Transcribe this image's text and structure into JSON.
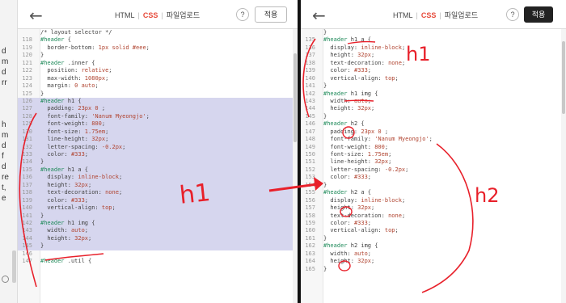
{
  "left": {
    "sidebar_chars": [
      "d",
      "m",
      "d",
      "rr",
      "",
      "",
      "",
      "h",
      "m",
      "d",
      "f",
      "d",
      "re",
      "t,",
      "e",
      ""
    ],
    "tabs": [
      {
        "label": "HTML",
        "active": false
      },
      {
        "label": "CSS",
        "active": true
      },
      {
        "label": "파일업로드",
        "active": false
      }
    ],
    "help_label": "?",
    "apply_label": "적용",
    "lines": [
      {
        "n": "",
        "parts": [
          [
            "c",
            "/* layout selector */"
          ]
        ]
      },
      {
        "n": "118",
        "parts": [
          [
            "s",
            "#header"
          ],
          [
            "p",
            " {"
          ]
        ]
      },
      {
        "n": "119",
        "parts": [
          [
            "p",
            "  border-bottom: "
          ],
          [
            "v",
            "1px solid #eee"
          ],
          [
            "p",
            ";"
          ]
        ]
      },
      {
        "n": "120",
        "parts": [
          [
            "p",
            "}"
          ]
        ]
      },
      {
        "n": "121",
        "parts": [
          [
            "s",
            "#header"
          ],
          [
            "p",
            " .inner {"
          ]
        ]
      },
      {
        "n": "122",
        "parts": [
          [
            "p",
            "  position: "
          ],
          [
            "v",
            "relative"
          ],
          [
            "p",
            ";"
          ]
        ]
      },
      {
        "n": "123",
        "parts": [
          [
            "p",
            "  max-width: "
          ],
          [
            "v",
            "1080px"
          ],
          [
            "p",
            ";"
          ]
        ]
      },
      {
        "n": "124",
        "parts": [
          [
            "p",
            "  margin: "
          ],
          [
            "v",
            "0 auto"
          ],
          [
            "p",
            ";"
          ]
        ]
      },
      {
        "n": "125",
        "parts": [
          [
            "p",
            "}"
          ]
        ]
      },
      {
        "n": "126",
        "hl": true,
        "parts": [
          [
            "s",
            "#header"
          ],
          [
            "p",
            " h1 {"
          ]
        ]
      },
      {
        "n": "127",
        "hl": true,
        "parts": [
          [
            "p",
            "  padding: "
          ],
          [
            "v",
            "23px 0"
          ],
          [
            "p",
            " ;"
          ]
        ]
      },
      {
        "n": "128",
        "hl": true,
        "parts": [
          [
            "p",
            "  font-family: "
          ],
          [
            "v",
            "'Nanum Myeongjo'"
          ],
          [
            "p",
            ";"
          ]
        ]
      },
      {
        "n": "129",
        "hl": true,
        "parts": [
          [
            "p",
            "  font-weight: "
          ],
          [
            "v",
            "800"
          ],
          [
            "p",
            ";"
          ]
        ]
      },
      {
        "n": "130",
        "hl": true,
        "parts": [
          [
            "p",
            "  font-size: "
          ],
          [
            "v",
            "1.75em"
          ],
          [
            "p",
            ";"
          ]
        ]
      },
      {
        "n": "131",
        "hl": true,
        "parts": [
          [
            "p",
            "  line-height: "
          ],
          [
            "v",
            "32px"
          ],
          [
            "p",
            ";"
          ]
        ]
      },
      {
        "n": "132",
        "hl": true,
        "parts": [
          [
            "p",
            "  letter-spacing: "
          ],
          [
            "v",
            "-0.2px"
          ],
          [
            "p",
            ";"
          ]
        ]
      },
      {
        "n": "133",
        "hl": true,
        "parts": [
          [
            "p",
            "  color: "
          ],
          [
            "v",
            "#333"
          ],
          [
            "p",
            ";"
          ]
        ]
      },
      {
        "n": "134",
        "hl": true,
        "parts": [
          [
            "p",
            "}"
          ]
        ]
      },
      {
        "n": "135",
        "hl": true,
        "parts": [
          [
            "s",
            "#header"
          ],
          [
            "p",
            " h1 a {"
          ]
        ]
      },
      {
        "n": "136",
        "hl": true,
        "parts": [
          [
            "p",
            "  display: "
          ],
          [
            "v",
            "inline-block"
          ],
          [
            "p",
            ";"
          ]
        ]
      },
      {
        "n": "137",
        "hl": true,
        "parts": [
          [
            "p",
            "  height: "
          ],
          [
            "v",
            "32px"
          ],
          [
            "p",
            ";"
          ]
        ]
      },
      {
        "n": "138",
        "hl": true,
        "parts": [
          [
            "p",
            "  text-decoration: "
          ],
          [
            "v",
            "none"
          ],
          [
            "p",
            ";"
          ]
        ]
      },
      {
        "n": "139",
        "hl": true,
        "parts": [
          [
            "p",
            "  color: "
          ],
          [
            "v",
            "#333"
          ],
          [
            "p",
            ";"
          ]
        ]
      },
      {
        "n": "140",
        "hl": true,
        "parts": [
          [
            "p",
            "  vertical-align: "
          ],
          [
            "v",
            "top"
          ],
          [
            "p",
            ";"
          ]
        ]
      },
      {
        "n": "141",
        "hl": true,
        "parts": [
          [
            "p",
            "}"
          ]
        ]
      },
      {
        "n": "142",
        "hl": true,
        "parts": [
          [
            "s",
            "#header"
          ],
          [
            "p",
            " h1 img {"
          ]
        ]
      },
      {
        "n": "143",
        "hl": true,
        "parts": [
          [
            "p",
            "  width: "
          ],
          [
            "v",
            "auto"
          ],
          [
            "p",
            ";"
          ]
        ]
      },
      {
        "n": "144",
        "hl": true,
        "parts": [
          [
            "p",
            "  height: "
          ],
          [
            "v",
            "32px"
          ],
          [
            "p",
            ";"
          ]
        ]
      },
      {
        "n": "145",
        "hl": true,
        "parts": [
          [
            "p",
            "}"
          ]
        ]
      },
      {
        "n": "146",
        "parts": [
          [
            "p",
            ""
          ]
        ]
      },
      {
        "n": "147",
        "parts": [
          [
            "s",
            "#header"
          ],
          [
            "p",
            " .util {"
          ]
        ]
      }
    ],
    "annotation": "h1"
  },
  "right": {
    "tabs": [
      {
        "label": "HTML",
        "active": false
      },
      {
        "label": "CSS",
        "active": true
      },
      {
        "label": "파일업로드",
        "active": false
      }
    ],
    "help_label": "?",
    "apply_label": "적용",
    "lines": [
      {
        "n": "",
        "parts": [
          [
            "p",
            "}"
          ]
        ]
      },
      {
        "n": "135",
        "parts": [
          [
            "s",
            "#header"
          ],
          [
            "p",
            " h1 a {"
          ]
        ]
      },
      {
        "n": "136",
        "parts": [
          [
            "p",
            "  display: "
          ],
          [
            "v",
            "inline-block"
          ],
          [
            "p",
            ";"
          ]
        ]
      },
      {
        "n": "137",
        "parts": [
          [
            "p",
            "  height: "
          ],
          [
            "v",
            "32px"
          ],
          [
            "p",
            ";"
          ]
        ]
      },
      {
        "n": "138",
        "parts": [
          [
            "p",
            "  text-decoration: "
          ],
          [
            "v",
            "none"
          ],
          [
            "p",
            ";"
          ]
        ]
      },
      {
        "n": "139",
        "parts": [
          [
            "p",
            "  color: "
          ],
          [
            "v",
            "#333"
          ],
          [
            "p",
            ";"
          ]
        ]
      },
      {
        "n": "140",
        "parts": [
          [
            "p",
            "  vertical-align: "
          ],
          [
            "v",
            "top"
          ],
          [
            "p",
            ";"
          ]
        ]
      },
      {
        "n": "141",
        "parts": [
          [
            "p",
            "}"
          ]
        ]
      },
      {
        "n": "142",
        "parts": [
          [
            "s",
            "#header"
          ],
          [
            "p",
            " h1 img {"
          ]
        ]
      },
      {
        "n": "143",
        "parts": [
          [
            "p",
            "  width: "
          ],
          [
            "v",
            "auto"
          ],
          [
            "p",
            ";"
          ]
        ]
      },
      {
        "n": "144",
        "parts": [
          [
            "p",
            "  height: "
          ],
          [
            "v",
            "32px"
          ],
          [
            "p",
            ";"
          ]
        ]
      },
      {
        "n": "145",
        "parts": [
          [
            "p",
            "}"
          ]
        ]
      },
      {
        "n": "146",
        "parts": [
          [
            "s",
            "#header"
          ],
          [
            "p",
            " h2 {"
          ]
        ]
      },
      {
        "n": "147",
        "parts": [
          [
            "p",
            "  padding: "
          ],
          [
            "v",
            "23px 0"
          ],
          [
            "p",
            " ;"
          ]
        ]
      },
      {
        "n": "148",
        "parts": [
          [
            "p",
            "  font-family: "
          ],
          [
            "v",
            "'Nanum Myeongjo'"
          ],
          [
            "p",
            ";"
          ]
        ]
      },
      {
        "n": "149",
        "parts": [
          [
            "p",
            "  font-weight: "
          ],
          [
            "v",
            "800"
          ],
          [
            "p",
            ";"
          ]
        ]
      },
      {
        "n": "150",
        "parts": [
          [
            "p",
            "  font-size: "
          ],
          [
            "v",
            "1.75em"
          ],
          [
            "p",
            ";"
          ]
        ]
      },
      {
        "n": "151",
        "parts": [
          [
            "p",
            "  line-height: "
          ],
          [
            "v",
            "32px"
          ],
          [
            "p",
            ";"
          ]
        ]
      },
      {
        "n": "152",
        "parts": [
          [
            "p",
            "  letter-spacing: "
          ],
          [
            "v",
            "-0.2px"
          ],
          [
            "p",
            ";"
          ]
        ]
      },
      {
        "n": "153",
        "parts": [
          [
            "p",
            "  color: "
          ],
          [
            "v",
            "#333"
          ],
          [
            "p",
            ";"
          ]
        ]
      },
      {
        "n": "154",
        "parts": [
          [
            "p",
            "}"
          ]
        ]
      },
      {
        "n": "155",
        "parts": [
          [
            "s",
            "#header"
          ],
          [
            "p",
            " h2 a {"
          ]
        ]
      },
      {
        "n": "156",
        "parts": [
          [
            "p",
            "  display: "
          ],
          [
            "v",
            "inline-block"
          ],
          [
            "p",
            ";"
          ]
        ]
      },
      {
        "n": "157",
        "parts": [
          [
            "p",
            "  height: "
          ],
          [
            "v",
            "32px"
          ],
          [
            "p",
            ";"
          ]
        ]
      },
      {
        "n": "158",
        "parts": [
          [
            "p",
            "  text-decoration: "
          ],
          [
            "v",
            "none"
          ],
          [
            "p",
            ";"
          ]
        ]
      },
      {
        "n": "159",
        "parts": [
          [
            "p",
            "  color: "
          ],
          [
            "v",
            "#333"
          ],
          [
            "p",
            ";"
          ]
        ]
      },
      {
        "n": "160",
        "parts": [
          [
            "p",
            "  vertical-align: "
          ],
          [
            "v",
            "top"
          ],
          [
            "p",
            ";"
          ]
        ]
      },
      {
        "n": "161",
        "parts": [
          [
            "p",
            "}"
          ]
        ]
      },
      {
        "n": "162",
        "parts": [
          [
            "s",
            "#header"
          ],
          [
            "p",
            " h2 img {"
          ]
        ]
      },
      {
        "n": "163",
        "parts": [
          [
            "p",
            "  width: "
          ],
          [
            "v",
            "auto"
          ],
          [
            "p",
            ";"
          ]
        ]
      },
      {
        "n": "164",
        "parts": [
          [
            "p",
            "  height: "
          ],
          [
            "v",
            "32px"
          ],
          [
            "p",
            ";"
          ]
        ]
      },
      {
        "n": "165",
        "parts": [
          [
            "p",
            "}"
          ]
        ]
      }
    ],
    "annotation_top": "h1",
    "annotation_bottom": "h2"
  },
  "colors": {
    "selector": "#1f8a5a",
    "value": "#b0432f",
    "highlight": "#d6d6ee",
    "annotation": "#e8202a",
    "active_tab": "#e74c3c"
  }
}
